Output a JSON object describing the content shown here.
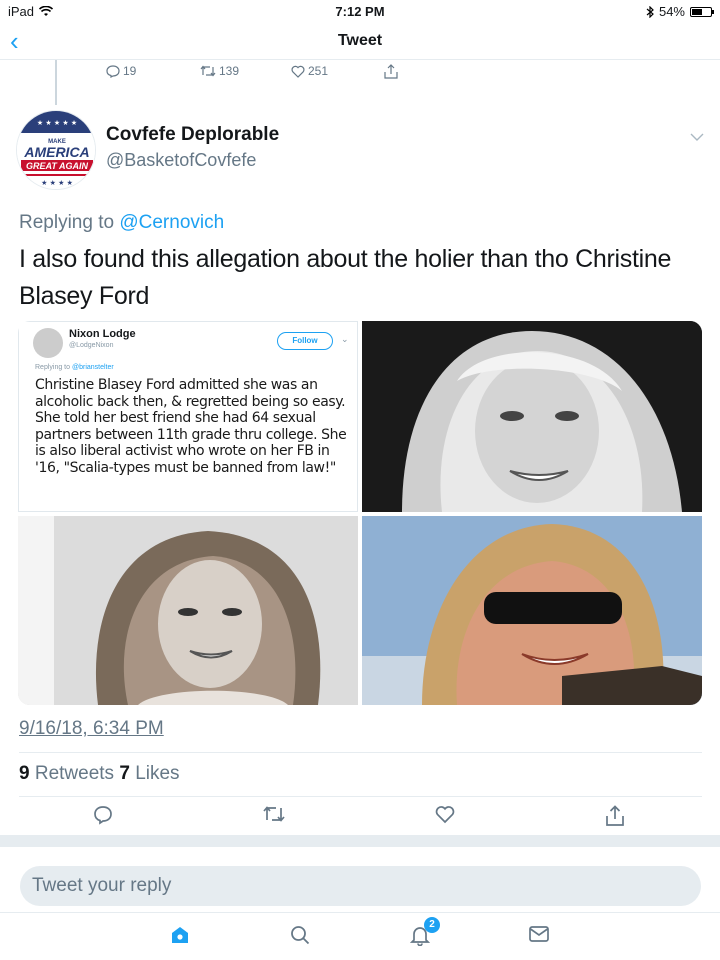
{
  "status_bar": {
    "device": "iPad",
    "time": "7:12 PM",
    "battery": "54%",
    "battery_level": 0.54
  },
  "nav": {
    "title": "Tweet"
  },
  "parent_tweet": {
    "replies": "19",
    "retweets": "139",
    "likes": "251"
  },
  "tweet": {
    "author_name": "Covfefe Deplorable",
    "author_handle": "@BasketofCovfefe",
    "replying_prefix": "Replying to",
    "replying_to": "@Cernovich",
    "text": "I also found this allegation about the holier than tho Christine Blasey Ford",
    "timestamp": "9/16/18, 6:34 PM",
    "retweets_count": "9",
    "retweets_label": "Retweets",
    "likes_count": "7",
    "likes_label": "Likes"
  },
  "avatar_logo": {
    "line1": "MAKE",
    "line2": "AMERICA",
    "line3": "GREAT AGAIN"
  },
  "embedded_tweet": {
    "name": "Nixon Lodge",
    "handle": "@LodgeNixon",
    "follow_label": "Follow",
    "replying_prefix": "Replying to",
    "replying_to": "@brianstelter",
    "text": "Christine Blasey Ford admitted she was an alcoholic back then, & regretted being so easy. She told her best friend she had 64 sexual partners between 11th grade thru college. She is also liberal activist who wrote on her FB in '16, \"Scalia-types must be banned from law!\""
  },
  "reply_box": {
    "placeholder": "Tweet your reply"
  },
  "tab_bar": {
    "notifications_badge": "2"
  },
  "colors": {
    "accent": "#1da1f2",
    "secondary_text": "#657786",
    "divider": "#e6ecf0"
  }
}
